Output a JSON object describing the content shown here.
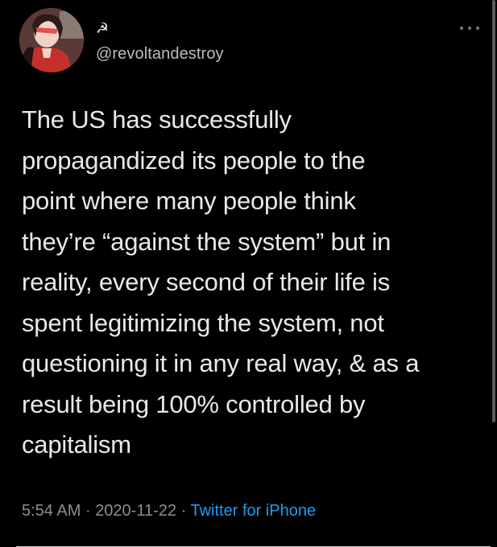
{
  "tweet": {
    "display_name_icon": "☭",
    "handle": "@revoltandestroy",
    "text": "The US has successfully\npropagandized its people to the\npoint where many people think\nthey’re “against the system” but in\nreality, every second of their life is\nspent legitimizing the system, not\nquestioning it in any real way, & as a\nresult being 100% controlled by\ncapitalism",
    "time": "5:54 AM",
    "separator": "·",
    "date": "2020-11-22",
    "source": "Twitter for iPhone"
  },
  "icons": {
    "more": "more-options-icon",
    "avatar": "avatar"
  },
  "colors": {
    "background": "#000000",
    "text": "#e7e9ea",
    "secondary": "#8b8f94",
    "link": "#1d9bf0"
  }
}
